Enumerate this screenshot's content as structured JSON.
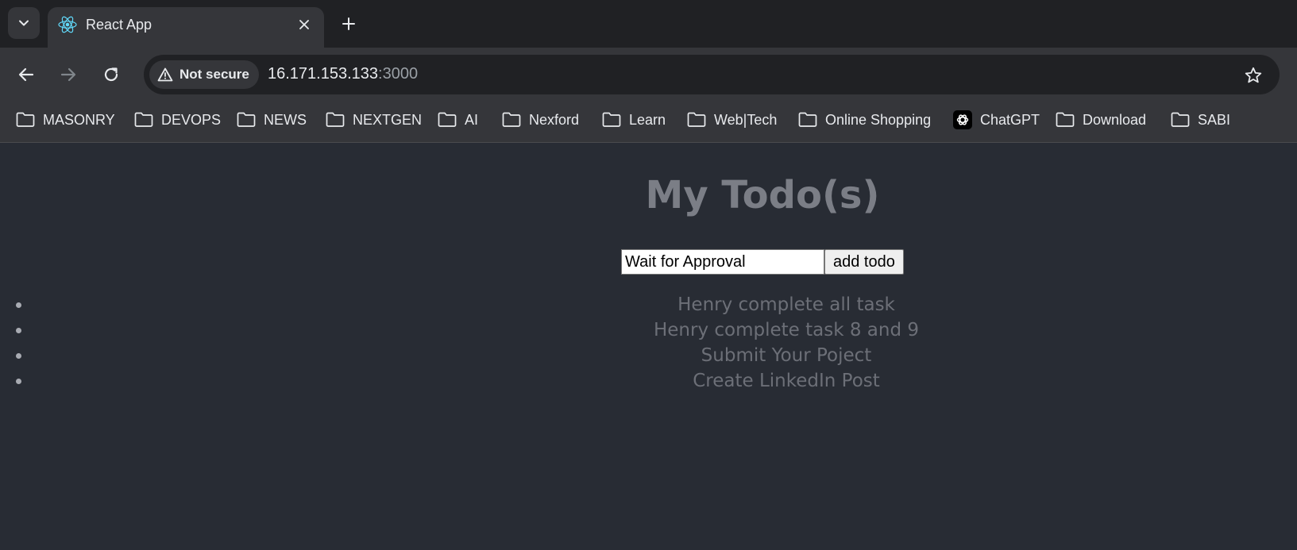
{
  "browser": {
    "tab": {
      "title": "React App",
      "favicon": "react-logo-icon"
    },
    "address": {
      "security_label": "Not secure",
      "host": "16.171.153.133",
      "port": ":3000"
    },
    "bookmarks": [
      {
        "label": "MASONRY",
        "icon": "folder-icon"
      },
      {
        "label": "DEVOPS",
        "icon": "folder-icon"
      },
      {
        "label": "NEWS",
        "icon": "folder-icon"
      },
      {
        "label": "NEXTGEN",
        "icon": "folder-icon"
      },
      {
        "label": "AI",
        "icon": "folder-icon"
      },
      {
        "label": "Nexford",
        "icon": "folder-icon"
      },
      {
        "label": "Learn",
        "icon": "folder-icon"
      },
      {
        "label": "Web|Tech",
        "icon": "folder-icon"
      },
      {
        "label": "Online Shopping",
        "icon": "folder-icon"
      },
      {
        "label": "ChatGPT",
        "icon": "chatgpt-icon"
      },
      {
        "label": "Download",
        "icon": "folder-icon"
      },
      {
        "label": "SABI",
        "icon": "folder-icon"
      }
    ]
  },
  "app": {
    "title": "My Todo(s)",
    "input": {
      "value": "Wait for Approval"
    },
    "add_button_label": "add todo",
    "todos": [
      "Henry complete all task",
      "Henry complete task 8 and 9",
      "Submit Your Poject",
      "Create LinkedIn Post"
    ]
  },
  "colors": {
    "page_background": "#282c34",
    "title_text": "#7b7e86",
    "browser_frame": "#202124",
    "toolbar": "#35363a"
  }
}
